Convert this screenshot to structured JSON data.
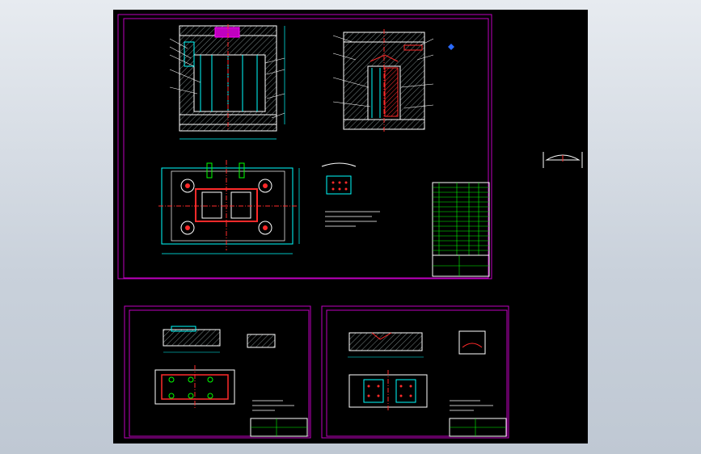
{
  "viewer": {
    "background": "#000000",
    "frame_color": "#c000c0",
    "sheet_count": 3
  },
  "colors": {
    "frame": "#c000c0",
    "outline": "#00ffff",
    "hatch": "#ffffff",
    "red": "#ff2a2a",
    "green": "#00ff00",
    "blue": "#2b6bff",
    "yellow": "#ffff00"
  },
  "icons": [
    "mold-assembly-drawing",
    "title-block",
    "bom-table",
    "detail-drawing"
  ]
}
